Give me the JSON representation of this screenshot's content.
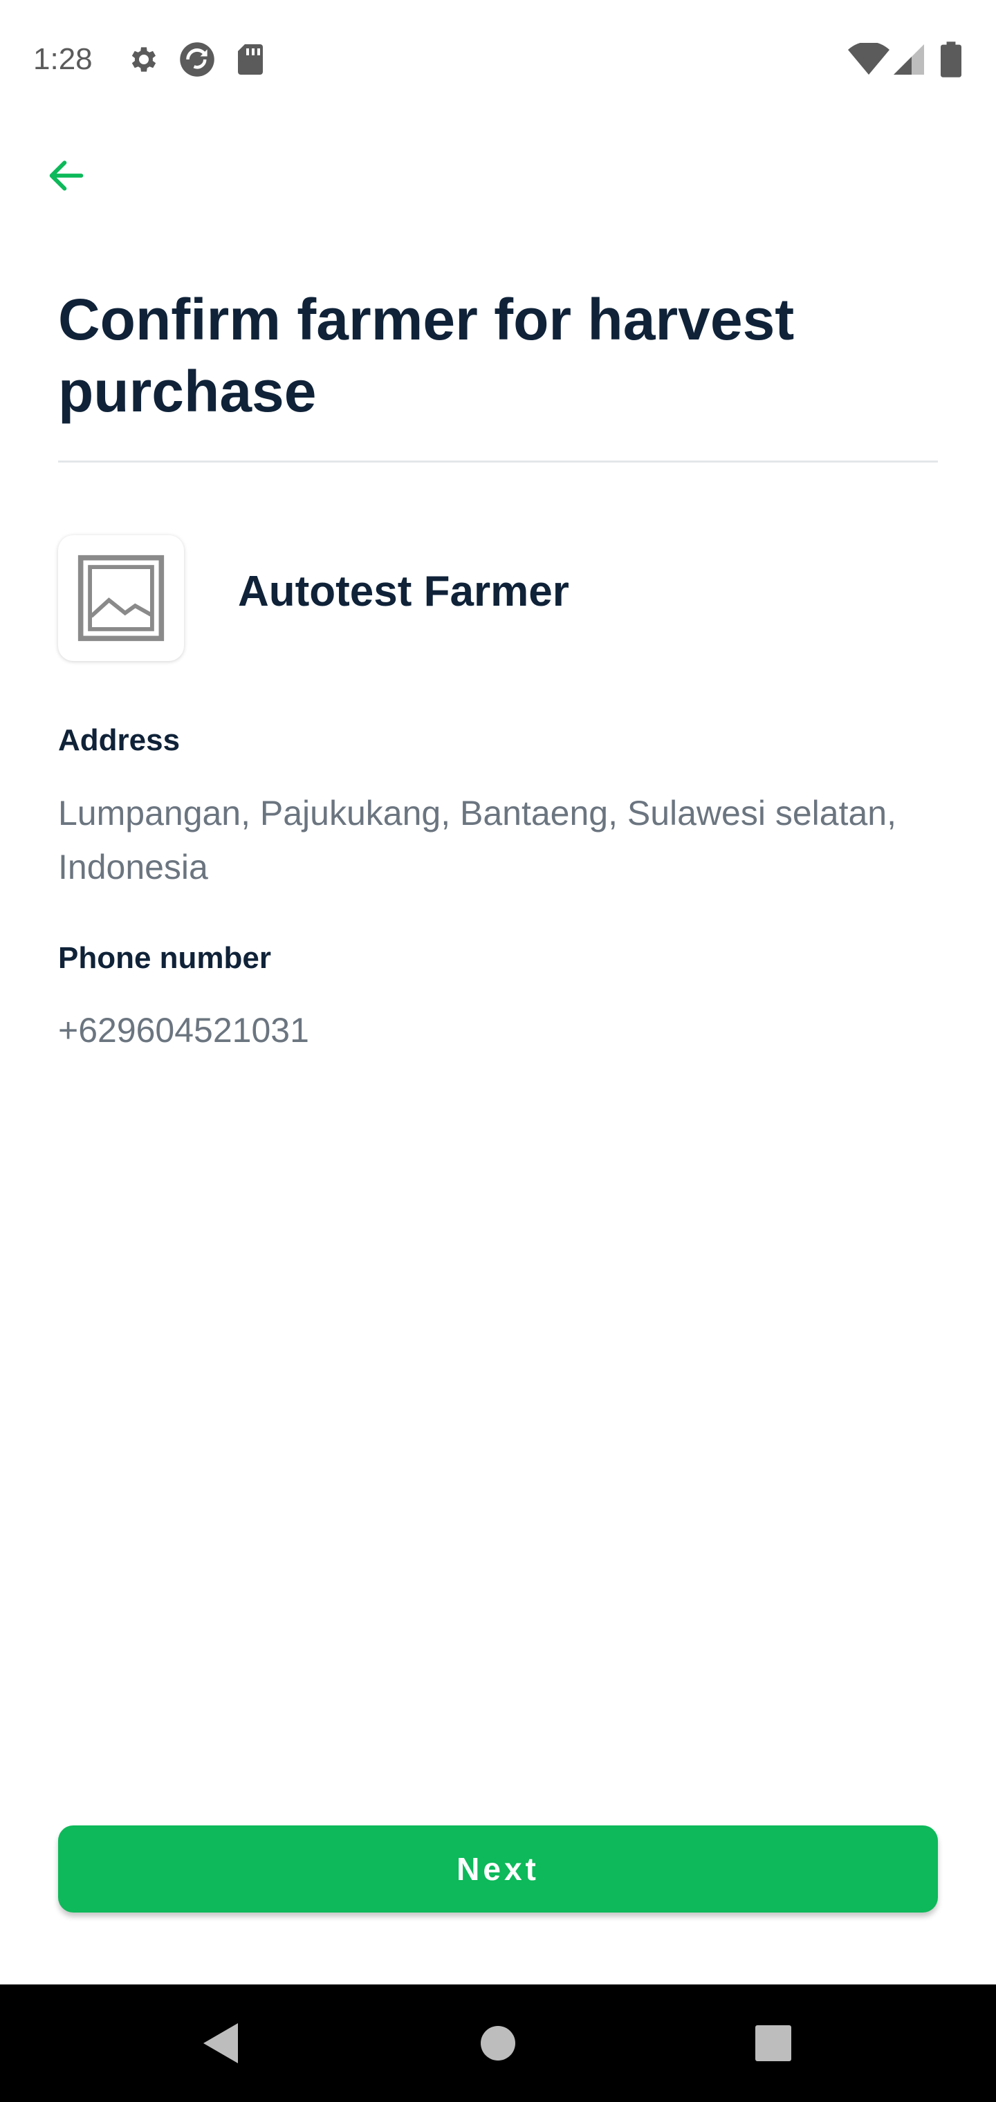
{
  "status_bar": {
    "time": "1:28",
    "icons": [
      "settings-gear-icon",
      "sync-icon",
      "sd-card-icon",
      "wifi-icon",
      "signal-icon",
      "battery-icon"
    ]
  },
  "header": {
    "back_icon": "arrow-left-icon",
    "title": "Confirm farmer for harvest purchase"
  },
  "farmer": {
    "avatar_icon": "image-placeholder-icon",
    "name": "Autotest Farmer"
  },
  "details": {
    "address_label": "Address",
    "address_value": "Lumpangan, Pajukukang, Bantaeng, Sulawesi selatan, Indonesia",
    "phone_label": "Phone number",
    "phone_value": "+629604521031"
  },
  "actions": {
    "next_label": "Next"
  },
  "navigation": {
    "icons": [
      "nav-back-icon",
      "nav-home-icon",
      "nav-recents-icon"
    ]
  },
  "colors": {
    "accent": "#0db95a",
    "title_text": "#0f2238",
    "secondary_text": "#6b7580",
    "divider": "#e4e6e8",
    "nav_bar": "#000000"
  }
}
